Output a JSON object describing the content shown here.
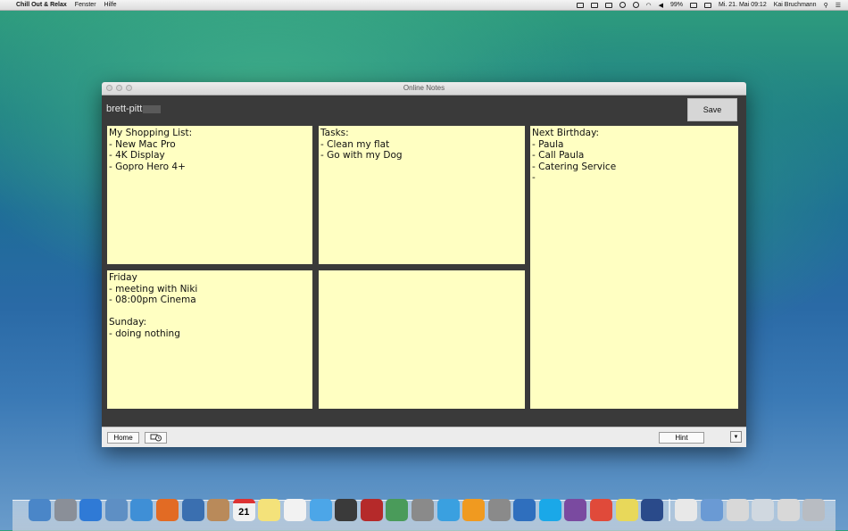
{
  "menubar": {
    "app_name": "Chill Out & Relax",
    "items": [
      "Fenster",
      "Hilfe"
    ],
    "battery": "99%",
    "datetime": "Mi. 21. Mai  09:12",
    "user": "Kai Bruchmann"
  },
  "window": {
    "title": "Online Notes",
    "username": "brett-pitt",
    "save_label": "Save",
    "notes": [
      "My Shopping List:\n- New Mac Pro\n- 4K Display\n- Gopro Hero 4+",
      "Tasks:\n- Clean my flat\n- Go with my Dog",
      "Next Birthday:\n- Paula\n- Call Paula\n- Catering Service\n-",
      "Friday\n- meeting with Niki\n- 08:00pm Cinema\n\nSunday:\n- doing nothing",
      ""
    ],
    "home_label": "Home",
    "hint_label": "Hint",
    "menu_glyph": "▼"
  },
  "dock": {
    "calendar_day": "21",
    "icons": [
      "finder-icon",
      "launchpad-icon",
      "app-store-icon",
      "preview-icon",
      "safari-icon",
      "firefox-icon",
      "camera-icon",
      "contacts-icon",
      "calendar-icon",
      "notes-icon",
      "reminders-icon",
      "messages-icon",
      "facetime-icon",
      "photo-booth-icon",
      "iphoto-icon",
      "image-capture-icon",
      "itunes-icon",
      "ibooks-icon",
      "system-preferences-icon",
      "xcode-icon",
      "skype-icon",
      "winrar-icon",
      "chrome-icon",
      "stickies-icon",
      "monitor-icon",
      "document-icon",
      "downloads-folder-icon",
      "screenshot-icon",
      "screenshot2-icon",
      "screenshot3-icon",
      "trash-icon"
    ],
    "colors": [
      "#4a86c8",
      "#8a8f98",
      "#2f7ad6",
      "#5e8fc4",
      "#3f8fd6",
      "#e26b24",
      "#3a6fb0",
      "#b98a5a",
      "#f2f2f2",
      "#f4e27a",
      "#f2f2f2",
      "#4ca6e8",
      "#3a3a3a",
      "#b52a2a",
      "#4a9b5a",
      "#8a8a8a",
      "#3aa0e0",
      "#f09a20",
      "#8a8a8a",
      "#2f6fbe",
      "#1aa8e8",
      "#7a4aa0",
      "#e04a3a",
      "#e8d85a",
      "#2a4a8a",
      "#e8e8e8",
      "#6a9ad4",
      "#d8d8d8",
      "#d0d8e0",
      "#d8d8d8",
      "#b8bcc2"
    ]
  }
}
